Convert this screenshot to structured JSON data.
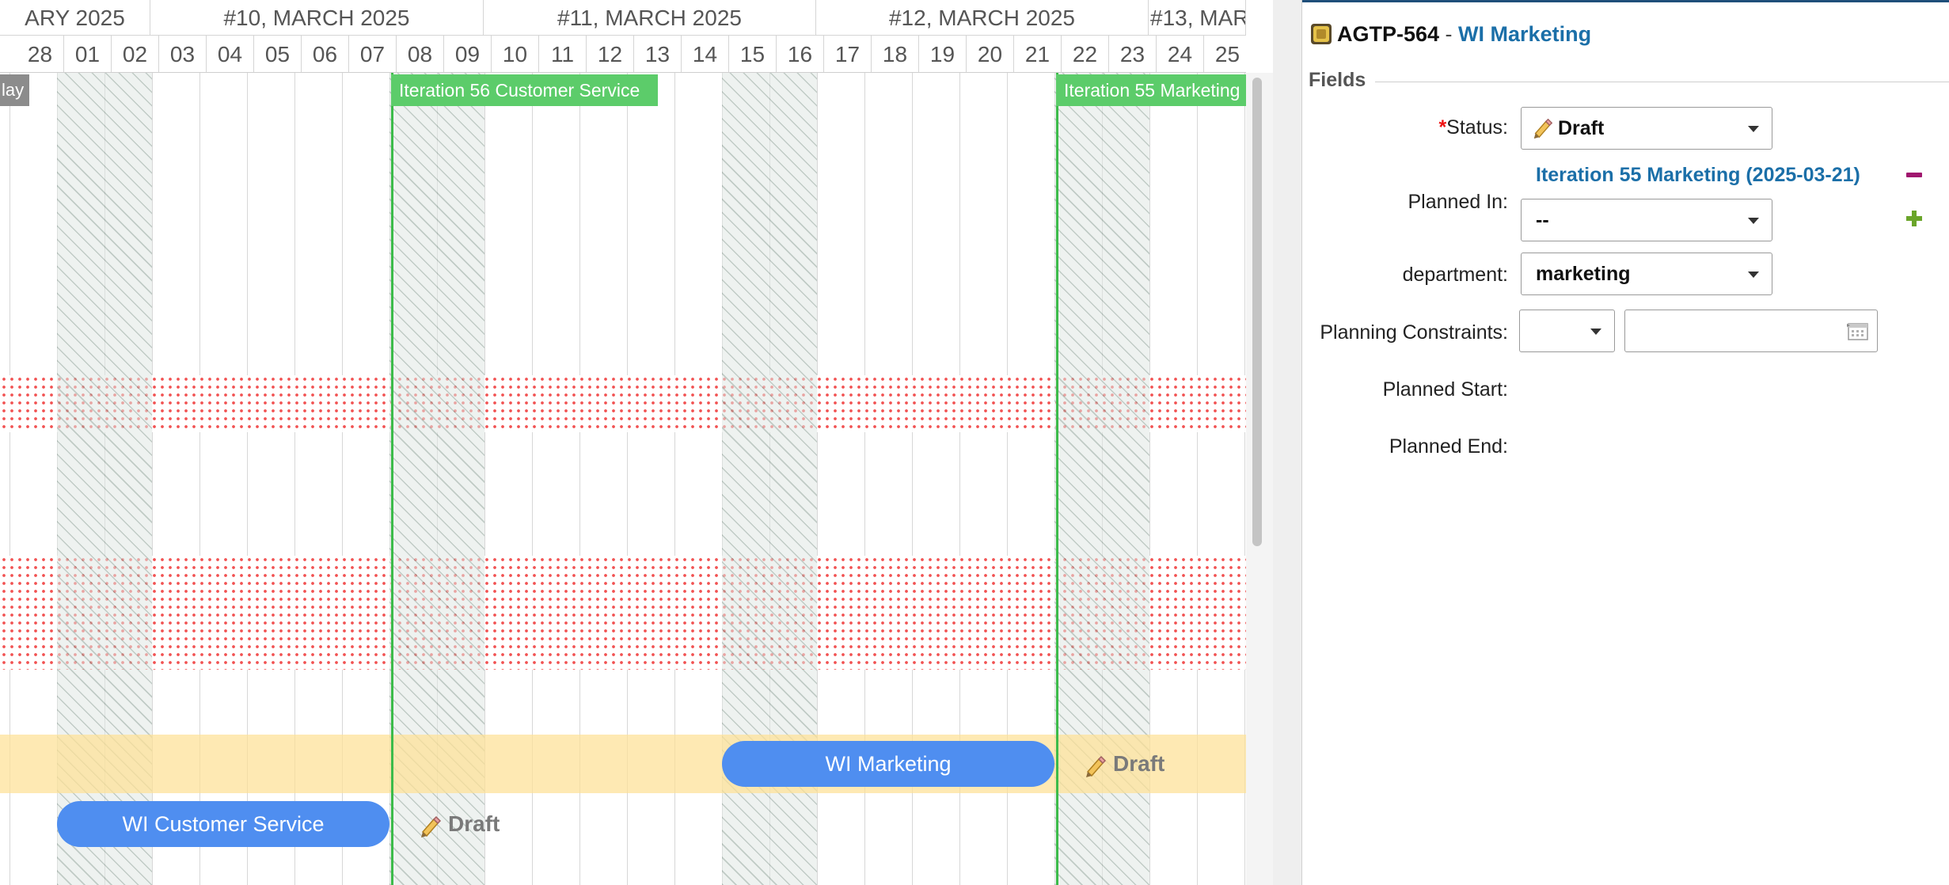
{
  "gantt": {
    "weeks": [
      {
        "label": "ARY 2025"
      },
      {
        "label": "#10, MARCH 2025"
      },
      {
        "label": "#11, MARCH 2025"
      },
      {
        "label": "#12, MARCH 2025"
      },
      {
        "label": "#13, MAR"
      }
    ],
    "days": [
      "28",
      "01",
      "02",
      "03",
      "04",
      "05",
      "06",
      "07",
      "08",
      "09",
      "10",
      "11",
      "12",
      "13",
      "14",
      "15",
      "16",
      "17",
      "18",
      "19",
      "20",
      "21",
      "22",
      "23",
      "24",
      "25"
    ],
    "today_tab": "lay",
    "iterations": [
      {
        "label": "Iteration 56 Customer Service",
        "color": "#5ccc6a"
      },
      {
        "label": "Iteration 55 Marketing",
        "color": "#5ccc6a"
      }
    ],
    "tasks": [
      {
        "label": "WI Marketing",
        "status": "Draft",
        "color": "#4f8ef0"
      },
      {
        "label": "WI Customer Service",
        "status": "Draft",
        "color": "#4f8ef0"
      }
    ]
  },
  "panel": {
    "item_key": "AGTP-564",
    "separator": " - ",
    "item_title": "WI Marketing",
    "section": "Fields",
    "fields": {
      "status_label": "Status:",
      "status_required_mark": "*",
      "status_value": "Draft",
      "planned_in_label": "Planned In:",
      "planned_in_link": "Iteration 55 Marketing (2025-03-21)",
      "planned_in_select": "--",
      "department_label": "department:",
      "department_value": "marketing",
      "constraints_label": "Planning Constraints:",
      "constraints_value": "",
      "planned_start_label": "Planned Start:",
      "planned_end_label": "Planned End:"
    }
  },
  "icons": {
    "status": "pencil-icon",
    "remove": "minus-icon",
    "add": "plus-icon",
    "calendar": "calendar-icon",
    "item": "work-item-icon"
  },
  "colors": {
    "accent_link": "#1b6fa8",
    "iteration_green": "#5ccc6a",
    "task_blue": "#4f8ef0",
    "row_highlight": "#fde096",
    "required": "#ee1111"
  }
}
